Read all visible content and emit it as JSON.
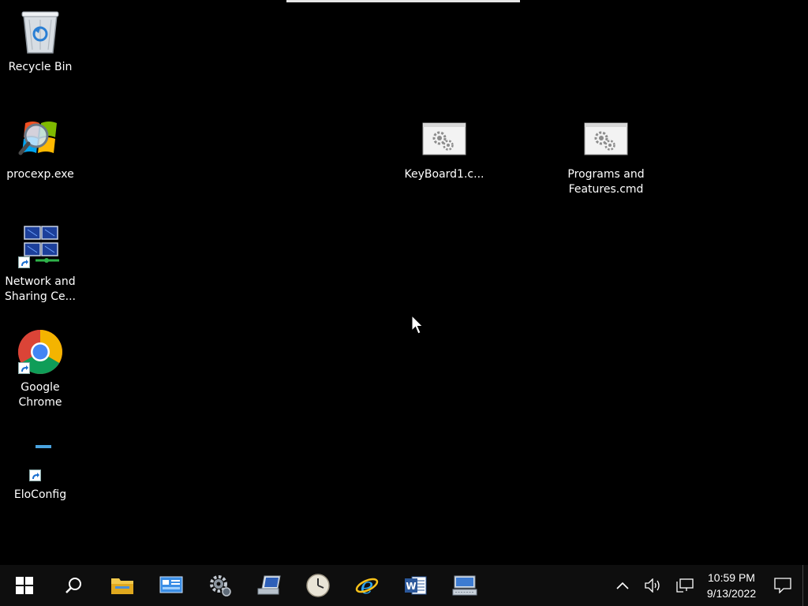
{
  "desktop": {
    "icons": [
      {
        "name": "recycle-bin",
        "label": "Recycle Bin",
        "icon": "recycle-bin-icon"
      },
      {
        "name": "procexp",
        "label": "procexp.exe",
        "icon": "windows-magnifier-icon"
      },
      {
        "name": "network-sharing",
        "label": "Network and\nSharing Ce...",
        "icon": "network-computers-icon"
      },
      {
        "name": "google-chrome",
        "label": "Google\nChrome",
        "icon": "chrome-icon"
      },
      {
        "name": "eloconfig",
        "label": "EloConfig",
        "icon": "eloconfig-icon"
      },
      {
        "name": "keyboard1",
        "label": "KeyBoard1.c...",
        "icon": "cmd-script-icon"
      },
      {
        "name": "programs-features",
        "label": "Programs and\nFeatures.cmd",
        "icon": "cmd-script-icon"
      }
    ]
  },
  "taskbar": {
    "buttons": [
      {
        "name": "start-button",
        "icon": "windows-logo-icon"
      },
      {
        "name": "search-button",
        "icon": "search-icon"
      },
      {
        "name": "file-explorer-button",
        "icon": "folder-icon"
      },
      {
        "name": "control-panel-button",
        "icon": "control-panel-icon"
      },
      {
        "name": "settings-button",
        "icon": "gear-icon"
      },
      {
        "name": "remote-desktop-button",
        "icon": "computer-icon"
      },
      {
        "name": "clock-app-button",
        "icon": "clock-icon"
      },
      {
        "name": "internet-explorer-button",
        "icon": "ie-icon"
      },
      {
        "name": "word-button",
        "icon": "word-icon"
      },
      {
        "name": "keyboard-app-button",
        "icon": "keyboard-icon"
      }
    ],
    "tray": {
      "time": "10:59 PM",
      "date": "9/13/2022",
      "icons": [
        "chevron-up-icon",
        "speaker-icon",
        "network-icon",
        "notification-icon"
      ]
    }
  },
  "colors": {
    "desktop_bg": "#000000",
    "taskbar_bg": "#0e0e0e",
    "accent": "#3a96dd"
  }
}
